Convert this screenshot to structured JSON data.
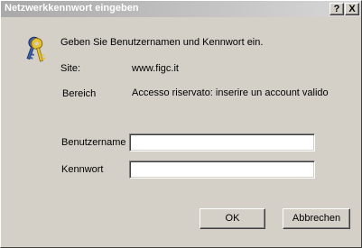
{
  "window": {
    "title": "Netzwerkkennwort eingeben",
    "help_label": "?",
    "close_label": "X"
  },
  "dialog": {
    "intro": "Geben Sie Benutzernamen und Kennwort ein.",
    "site_label": "Site:",
    "site_value": "www.figc.it",
    "area_label": "Bereich",
    "area_value": "Accesso riservato: inserire un account valido",
    "username_label": "Benutzername",
    "username_value": "",
    "password_label": "Kennwort",
    "password_value": ""
  },
  "buttons": {
    "ok": "OK",
    "cancel": "Abbrechen"
  },
  "icons": {
    "dialog_icon": "keys-icon"
  },
  "colors": {
    "face": "#d4d0c8",
    "title_gradient_start": "#a9a9a9",
    "title_gradient_end": "#d7d7d7"
  }
}
